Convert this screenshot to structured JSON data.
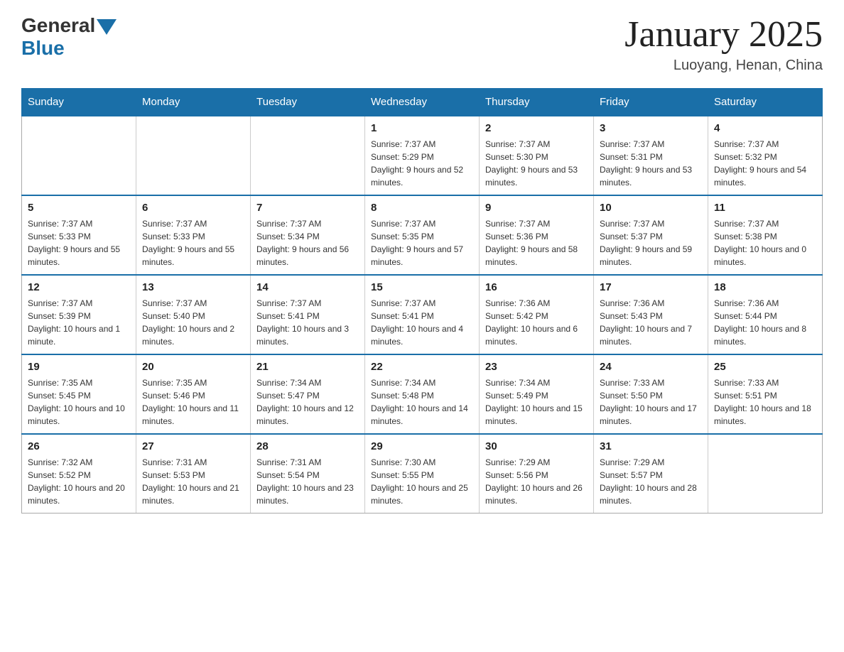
{
  "header": {
    "logo_general": "General",
    "logo_blue": "Blue",
    "title": "January 2025",
    "location": "Luoyang, Henan, China"
  },
  "days_of_week": [
    "Sunday",
    "Monday",
    "Tuesday",
    "Wednesday",
    "Thursday",
    "Friday",
    "Saturday"
  ],
  "weeks": [
    [
      {
        "day": "",
        "sunrise": "",
        "sunset": "",
        "daylight": ""
      },
      {
        "day": "",
        "sunrise": "",
        "sunset": "",
        "daylight": ""
      },
      {
        "day": "",
        "sunrise": "",
        "sunset": "",
        "daylight": ""
      },
      {
        "day": "1",
        "sunrise": "Sunrise: 7:37 AM",
        "sunset": "Sunset: 5:29 PM",
        "daylight": "Daylight: 9 hours and 52 minutes."
      },
      {
        "day": "2",
        "sunrise": "Sunrise: 7:37 AM",
        "sunset": "Sunset: 5:30 PM",
        "daylight": "Daylight: 9 hours and 53 minutes."
      },
      {
        "day": "3",
        "sunrise": "Sunrise: 7:37 AM",
        "sunset": "Sunset: 5:31 PM",
        "daylight": "Daylight: 9 hours and 53 minutes."
      },
      {
        "day": "4",
        "sunrise": "Sunrise: 7:37 AM",
        "sunset": "Sunset: 5:32 PM",
        "daylight": "Daylight: 9 hours and 54 minutes."
      }
    ],
    [
      {
        "day": "5",
        "sunrise": "Sunrise: 7:37 AM",
        "sunset": "Sunset: 5:33 PM",
        "daylight": "Daylight: 9 hours and 55 minutes."
      },
      {
        "day": "6",
        "sunrise": "Sunrise: 7:37 AM",
        "sunset": "Sunset: 5:33 PM",
        "daylight": "Daylight: 9 hours and 55 minutes."
      },
      {
        "day": "7",
        "sunrise": "Sunrise: 7:37 AM",
        "sunset": "Sunset: 5:34 PM",
        "daylight": "Daylight: 9 hours and 56 minutes."
      },
      {
        "day": "8",
        "sunrise": "Sunrise: 7:37 AM",
        "sunset": "Sunset: 5:35 PM",
        "daylight": "Daylight: 9 hours and 57 minutes."
      },
      {
        "day": "9",
        "sunrise": "Sunrise: 7:37 AM",
        "sunset": "Sunset: 5:36 PM",
        "daylight": "Daylight: 9 hours and 58 minutes."
      },
      {
        "day": "10",
        "sunrise": "Sunrise: 7:37 AM",
        "sunset": "Sunset: 5:37 PM",
        "daylight": "Daylight: 9 hours and 59 minutes."
      },
      {
        "day": "11",
        "sunrise": "Sunrise: 7:37 AM",
        "sunset": "Sunset: 5:38 PM",
        "daylight": "Daylight: 10 hours and 0 minutes."
      }
    ],
    [
      {
        "day": "12",
        "sunrise": "Sunrise: 7:37 AM",
        "sunset": "Sunset: 5:39 PM",
        "daylight": "Daylight: 10 hours and 1 minute."
      },
      {
        "day": "13",
        "sunrise": "Sunrise: 7:37 AM",
        "sunset": "Sunset: 5:40 PM",
        "daylight": "Daylight: 10 hours and 2 minutes."
      },
      {
        "day": "14",
        "sunrise": "Sunrise: 7:37 AM",
        "sunset": "Sunset: 5:41 PM",
        "daylight": "Daylight: 10 hours and 3 minutes."
      },
      {
        "day": "15",
        "sunrise": "Sunrise: 7:37 AM",
        "sunset": "Sunset: 5:41 PM",
        "daylight": "Daylight: 10 hours and 4 minutes."
      },
      {
        "day": "16",
        "sunrise": "Sunrise: 7:36 AM",
        "sunset": "Sunset: 5:42 PM",
        "daylight": "Daylight: 10 hours and 6 minutes."
      },
      {
        "day": "17",
        "sunrise": "Sunrise: 7:36 AM",
        "sunset": "Sunset: 5:43 PM",
        "daylight": "Daylight: 10 hours and 7 minutes."
      },
      {
        "day": "18",
        "sunrise": "Sunrise: 7:36 AM",
        "sunset": "Sunset: 5:44 PM",
        "daylight": "Daylight: 10 hours and 8 minutes."
      }
    ],
    [
      {
        "day": "19",
        "sunrise": "Sunrise: 7:35 AM",
        "sunset": "Sunset: 5:45 PM",
        "daylight": "Daylight: 10 hours and 10 minutes."
      },
      {
        "day": "20",
        "sunrise": "Sunrise: 7:35 AM",
        "sunset": "Sunset: 5:46 PM",
        "daylight": "Daylight: 10 hours and 11 minutes."
      },
      {
        "day": "21",
        "sunrise": "Sunrise: 7:34 AM",
        "sunset": "Sunset: 5:47 PM",
        "daylight": "Daylight: 10 hours and 12 minutes."
      },
      {
        "day": "22",
        "sunrise": "Sunrise: 7:34 AM",
        "sunset": "Sunset: 5:48 PM",
        "daylight": "Daylight: 10 hours and 14 minutes."
      },
      {
        "day": "23",
        "sunrise": "Sunrise: 7:34 AM",
        "sunset": "Sunset: 5:49 PM",
        "daylight": "Daylight: 10 hours and 15 minutes."
      },
      {
        "day": "24",
        "sunrise": "Sunrise: 7:33 AM",
        "sunset": "Sunset: 5:50 PM",
        "daylight": "Daylight: 10 hours and 17 minutes."
      },
      {
        "day": "25",
        "sunrise": "Sunrise: 7:33 AM",
        "sunset": "Sunset: 5:51 PM",
        "daylight": "Daylight: 10 hours and 18 minutes."
      }
    ],
    [
      {
        "day": "26",
        "sunrise": "Sunrise: 7:32 AM",
        "sunset": "Sunset: 5:52 PM",
        "daylight": "Daylight: 10 hours and 20 minutes."
      },
      {
        "day": "27",
        "sunrise": "Sunrise: 7:31 AM",
        "sunset": "Sunset: 5:53 PM",
        "daylight": "Daylight: 10 hours and 21 minutes."
      },
      {
        "day": "28",
        "sunrise": "Sunrise: 7:31 AM",
        "sunset": "Sunset: 5:54 PM",
        "daylight": "Daylight: 10 hours and 23 minutes."
      },
      {
        "day": "29",
        "sunrise": "Sunrise: 7:30 AM",
        "sunset": "Sunset: 5:55 PM",
        "daylight": "Daylight: 10 hours and 25 minutes."
      },
      {
        "day": "30",
        "sunrise": "Sunrise: 7:29 AM",
        "sunset": "Sunset: 5:56 PM",
        "daylight": "Daylight: 10 hours and 26 minutes."
      },
      {
        "day": "31",
        "sunrise": "Sunrise: 7:29 AM",
        "sunset": "Sunset: 5:57 PM",
        "daylight": "Daylight: 10 hours and 28 minutes."
      },
      {
        "day": "",
        "sunrise": "",
        "sunset": "",
        "daylight": ""
      }
    ]
  ]
}
